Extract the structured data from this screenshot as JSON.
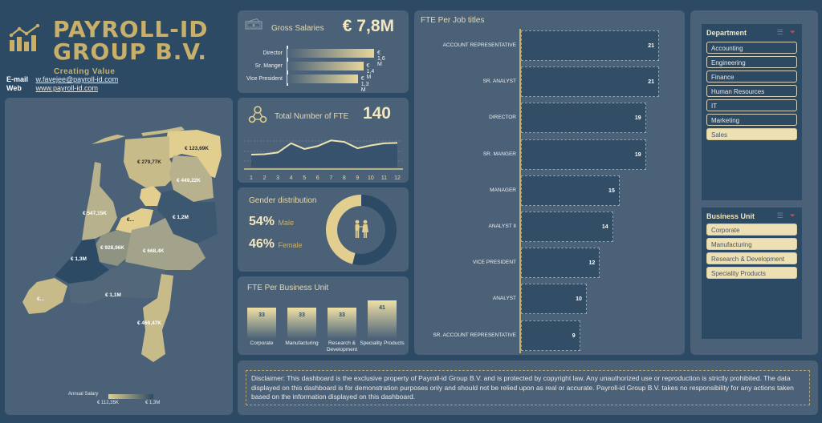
{
  "header": {
    "logo_line1": "PAYROLL-ID",
    "logo_line2": "GROUP B.V.",
    "tagline": "Creating Value",
    "email_label": "E-mail",
    "email_value": "w.favejee@payroll-id.com",
    "web_label": "Web",
    "web_value": "www.payroll-id.com"
  },
  "gross_salaries": {
    "title": "Gross Salaries",
    "value": "€ 7,8M",
    "icon": "money-icon",
    "rows": [
      {
        "label": "Director",
        "value": 1.6,
        "display": "€ 1,6 M"
      },
      {
        "label": "Sr. Manger",
        "value": 1.4,
        "display": "€ 1,4 M"
      },
      {
        "label": "Vice President",
        "value": 1.3,
        "display": "€ 1,3 M"
      }
    ]
  },
  "fte_total": {
    "title": "Total Number of FTE",
    "value": "140",
    "icon": "team-icon",
    "trend": {
      "x": [
        "1",
        "2",
        "3",
        "4",
        "5",
        "6",
        "7",
        "8",
        "9",
        "10",
        "11",
        "12"
      ],
      "y": [
        9,
        9.3,
        10.5,
        17,
        13,
        15,
        19,
        18,
        13.5,
        15.5,
        17,
        17.3
      ]
    }
  },
  "gender": {
    "title": "Gender distribution",
    "male_pct": "54%",
    "male_label": "Male",
    "female_pct": "46%",
    "female_label": "Female",
    "male_value": 54,
    "female_value": 46,
    "colors": {
      "male": "#2c4a63",
      "female": "#e2cf8f"
    }
  },
  "business_unit_chart": {
    "title": "FTE Per Business Unit",
    "items": [
      {
        "label": "Corporate",
        "value": 33
      },
      {
        "label": "Manufacturing",
        "value": 33
      },
      {
        "label": "Research & Development",
        "value": 33
      },
      {
        "label": "Speciality Products",
        "value": 41
      }
    ]
  },
  "chart_data": [
    {
      "type": "bar",
      "title": "FTE Per Job titles",
      "orientation": "horizontal",
      "categories": [
        "ACCOUNT REPRESENTATIVE",
        "SR. ANALYST",
        "DIRECTOR",
        "SR. MANGER",
        "MANAGER",
        "ANALYST II",
        "VICE PRESIDENT",
        "ANALYST",
        "SR. ACCOUNT REPRESENTATIVE"
      ],
      "values": [
        21,
        21,
        19,
        19,
        15,
        14,
        12,
        10,
        9
      ],
      "xlim": [
        0,
        21
      ]
    },
    {
      "type": "line",
      "title": "Total Number of FTE",
      "x": [
        "1",
        "2",
        "3",
        "4",
        "5",
        "6",
        "7",
        "8",
        "9",
        "10",
        "11",
        "12"
      ],
      "y": [
        9,
        9.3,
        10.5,
        17,
        13,
        15,
        19,
        18,
        13.5,
        15.5,
        17,
        17.3
      ]
    },
    {
      "type": "pie",
      "title": "Gender distribution",
      "categories": [
        "Male",
        "Female"
      ],
      "values": [
        54,
        46
      ]
    },
    {
      "type": "bar",
      "title": "FTE Per Business Unit",
      "categories": [
        "Corporate",
        "Manufacturing",
        "Research & Development",
        "Speciality Products"
      ],
      "values": [
        33,
        33,
        33,
        41
      ]
    },
    {
      "type": "bar",
      "title": "Gross Salaries",
      "orientation": "horizontal",
      "categories": [
        "Director",
        "Sr. Manger",
        "Vice President"
      ],
      "values": [
        1.6,
        1.4,
        1.3
      ],
      "unit": "€ M"
    }
  ],
  "job_titles": {
    "title": "FTE Per Job titles"
  },
  "map": {
    "labels": [
      {
        "text": "€ 123,69K"
      },
      {
        "text": "€ 279,77K"
      },
      {
        "text": "€ 449,22K"
      },
      {
        "text": "€ 547,15K"
      },
      {
        "text": "€..."
      },
      {
        "text": "€ 1,2M"
      },
      {
        "text": "€ 928,96K"
      },
      {
        "text": "€ 668,4K"
      },
      {
        "text": "€ 1,3M"
      },
      {
        "text": "€ 1,1M"
      },
      {
        "text": "€..."
      },
      {
        "text": "€ 466,47K"
      }
    ],
    "legend_title": "Annual Salary",
    "legend_min": "€ 112,35K",
    "legend_max": "€ 1,3M"
  },
  "department_slicer": {
    "title": "Department",
    "items": [
      {
        "label": "Accounting",
        "selected": false
      },
      {
        "label": "Engineering",
        "selected": false
      },
      {
        "label": "Finance",
        "selected": false
      },
      {
        "label": "Human Resources",
        "selected": false
      },
      {
        "label": "IT",
        "selected": false
      },
      {
        "label": "Marketing",
        "selected": false
      },
      {
        "label": "Sales",
        "selected": true
      }
    ]
  },
  "business_unit_slicer": {
    "title": "Business Unit",
    "items": [
      {
        "label": "Corporate",
        "selected": true
      },
      {
        "label": "Manufacturing",
        "selected": true
      },
      {
        "label": "Research & Development",
        "selected": true
      },
      {
        "label": "Speciality Products",
        "selected": true
      }
    ]
  },
  "disclaimer": "Disclaimer: This dashboard is the exclusive property of Payroll-id Group B.V. and is protected by copyright law. Any unauthorized use or reproduction is strictly prohibited. The data displayed on this dashboard is for demonstration purposes only and should not be relied upon as real or accurate. Payroll-id Group B.V. takes no responsibility for any actions taken based on the information displayed on this dashboard."
}
